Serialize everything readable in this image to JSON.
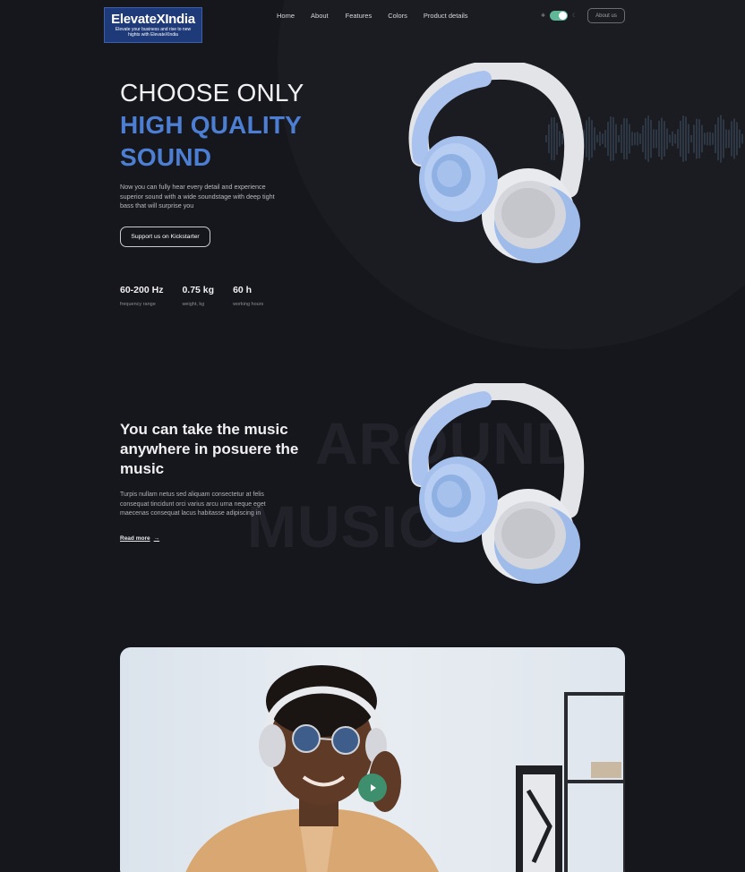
{
  "brand": {
    "name": "ElevateXIndia",
    "tagline": "Elevate your business and rise to new hights with ElevateXIndia"
  },
  "nav": {
    "items": [
      "Home",
      "About",
      "Features",
      "Colors",
      "Product details"
    ],
    "about_button": "About us"
  },
  "hero": {
    "title_line1": "CHOOSE ONLY",
    "title_line2": "HIGH QUALITY",
    "title_line3": "SOUND",
    "description": "Now you can fully hear every detail and experience superior sound with a wide soundstage with deep tight bass that will surprise you",
    "cta": "Support us on Kickstarter",
    "stats": [
      {
        "value": "60-200 Hz",
        "label": "frequency range"
      },
      {
        "value": "0.75 kg",
        "label": "weight, kg"
      },
      {
        "value": "60 h",
        "label": "working hours"
      }
    ]
  },
  "section2": {
    "bg_word1": "AROUND",
    "bg_word2": "MUSIC",
    "title": "You can take the music anywhere in posuere the music",
    "description": "Turpis nullam netus sed aliquam consectetur at felis consequat tincidunt orci varius arcu urna neque eget maecenas consequat lacus habitasse adipiscing in",
    "read_more": "Read more",
    "arrow": "→"
  },
  "colors": {
    "accent_blue": "#4c7fd3",
    "toggle_green": "#5fb797",
    "play_green": "#3d8f6e",
    "background": "#16171c"
  }
}
